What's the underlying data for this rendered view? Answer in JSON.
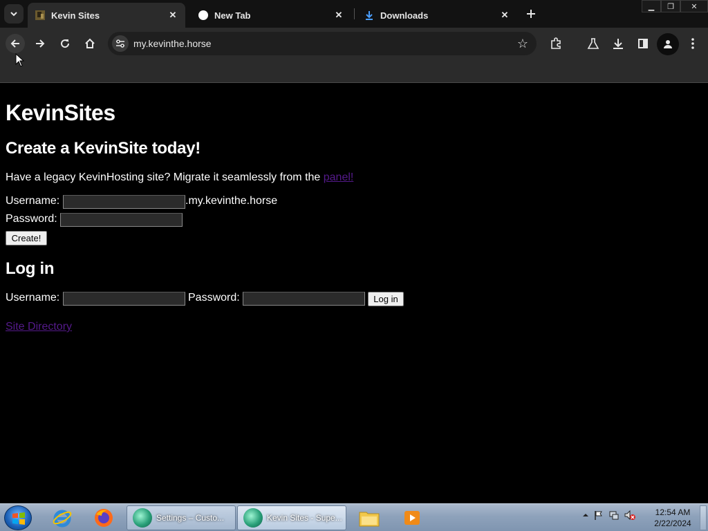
{
  "browser": {
    "tabs": [
      {
        "title": "Kevin Sites",
        "icon": "kevin-sites-favicon",
        "active": true
      },
      {
        "title": "New Tab",
        "icon": "chrome-favicon",
        "active": false
      },
      {
        "title": "Downloads",
        "icon": "download-icon",
        "active": false
      }
    ],
    "url": "my.kevinthe.horse"
  },
  "page": {
    "site_title": "KevinSites",
    "create_heading": "Create a KevinSite today!",
    "migrate_text": "Have a legacy KevinHosting site? Migrate it seamlessly from the ",
    "migrate_link": "panel!",
    "create_username_label": "Username:",
    "create_domain_suffix": ".my.kevinthe.horse",
    "create_password_label": "Password:",
    "create_button": "Create!",
    "login_heading": "Log in",
    "login_username_label": "Username:",
    "login_password_label": "Password:",
    "login_button": "Log in",
    "site_directory_link": "Site Directory",
    "link_color": "#551a8b"
  },
  "taskbar": {
    "tasks": [
      {
        "label": "Settings – Custo...",
        "active": false
      },
      {
        "label": "Kevin Sites - Supe...",
        "active": true
      }
    ],
    "clock_time": "12:54 AM",
    "clock_date": "2/22/2024"
  }
}
